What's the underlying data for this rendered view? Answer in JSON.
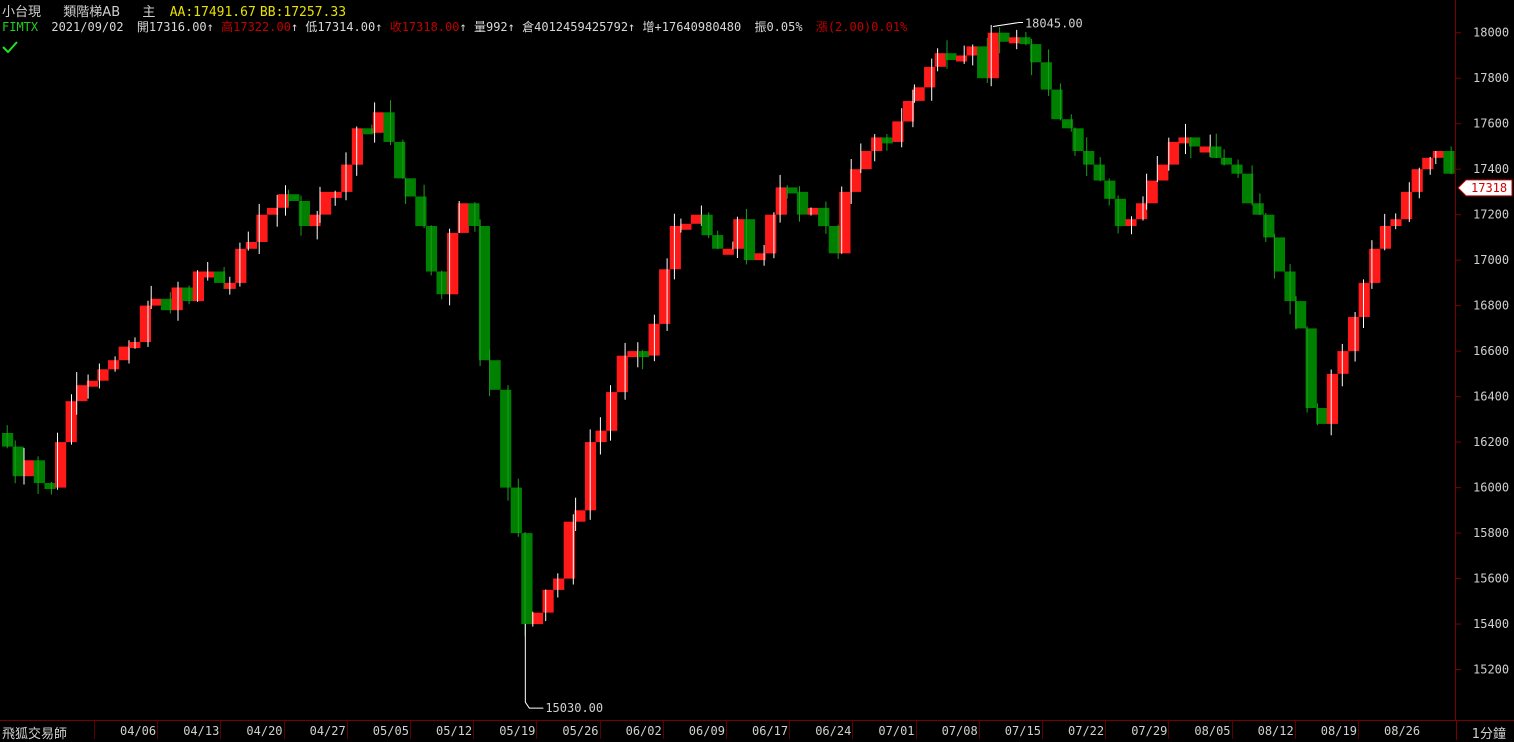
{
  "header": {
    "product": "小台現",
    "indicator_name": "類階梯AB",
    "main_label": "主",
    "aa_label": "AA:17491.67",
    "bb_label": "BB:17257.33"
  },
  "quote": {
    "symbol": "FIMTX",
    "date": "2021/09/02",
    "open": "開17316.00",
    "high": "高17322.00",
    "low": "低17314.00",
    "close": "收17318.00",
    "volume": "量992",
    "open_interest": "倉4012459425792",
    "oi_change": "增+17640980480",
    "amplitude": "振0.05%",
    "change": "漲(2.00)0.01%"
  },
  "colors": {
    "up": "#ff1a1a",
    "down": "#008000",
    "background": "#000000",
    "frame": "#7a0000",
    "price_tag_text": "#d00000"
  },
  "footer": {
    "brand": "飛狐交易師",
    "period": "1分鐘"
  },
  "chart_data": {
    "type": "area",
    "title": "",
    "xlabel": "",
    "ylabel": "",
    "ylim": [
      15000,
      18100
    ],
    "y_ticks": [
      "18000",
      "17800",
      "17600",
      "17400",
      "17200",
      "17000",
      "16800",
      "16600",
      "16400",
      "16200",
      "16000",
      "15800",
      "15600",
      "15400",
      "15200"
    ],
    "x_ticks": [
      "04/06",
      "04/13",
      "04/20",
      "04/27",
      "05/05",
      "05/12",
      "05/19",
      "05/26",
      "06/02",
      "06/09",
      "06/17",
      "06/24",
      "07/01",
      "07/08",
      "07/15",
      "07/22",
      "07/29",
      "08/05",
      "08/12",
      "08/19",
      "08/26"
    ],
    "last_price": "17318",
    "max_annotation": "18045.00",
    "min_annotation": "15030.00",
    "series": [
      {
        "values": [
          16180,
          16050,
          16120,
          16020,
          16000,
          16200,
          16380,
          16450,
          16470,
          16520,
          16560,
          16620,
          16640,
          16800,
          16830,
          16780,
          16880,
          16820,
          16950,
          16950,
          16900,
          16900,
          17050,
          17080,
          17200,
          17230,
          17290,
          17260,
          17150,
          17200,
          17300,
          17300,
          17420,
          17580,
          17560,
          17650,
          17520,
          17360,
          17280,
          17150,
          16950,
          16850,
          17120,
          17250,
          17150,
          16560,
          16430,
          16000,
          15800,
          15400,
          15450,
          15550,
          15600,
          15850,
          15900,
          16200,
          16250,
          16420,
          16580,
          16600,
          16580,
          16720,
          16960,
          17150,
          17160,
          17200,
          17110,
          17050,
          17050,
          17180,
          17000,
          17030,
          17200,
          17320,
          17300,
          17200,
          17230,
          17150,
          17030,
          17300,
          17400,
          17480,
          17540,
          17520,
          17610,
          17700,
          17760,
          17850,
          17910,
          17880,
          17900,
          17940,
          17800,
          18000,
          17960,
          17980,
          17950,
          17870,
          17750,
          17620,
          17580,
          17480,
          17420,
          17350,
          17270,
          17150,
          17180,
          17250,
          17350,
          17420,
          17520,
          17540,
          17500,
          17500,
          17450,
          17420,
          17380,
          17250,
          17200,
          17100,
          16950,
          16820,
          16700,
          16350,
          16280,
          16500,
          16600,
          16750,
          16900,
          17050,
          17150,
          17180,
          17300,
          17400,
          17450,
          17480,
          17380
        ]
      }
    ]
  }
}
